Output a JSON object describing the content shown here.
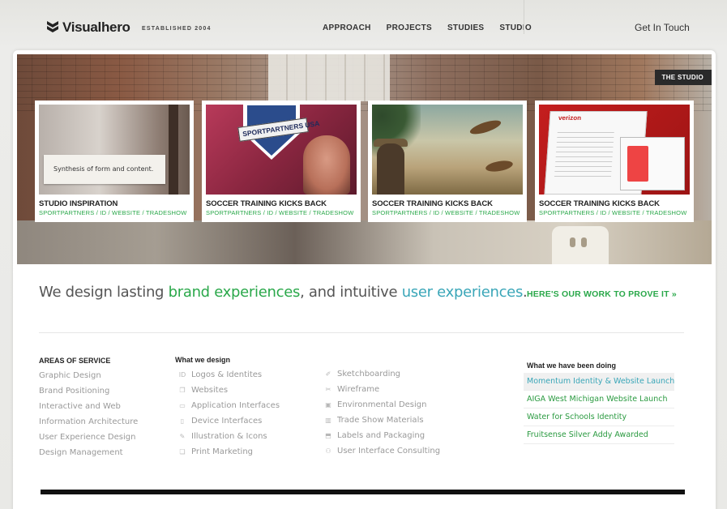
{
  "header": {
    "logo_text": "Visualhero",
    "tagline": "ESTABLISHED 2004",
    "nav": [
      "APPROACH",
      "PROJECTS",
      "STUDIES",
      "STUDIO"
    ],
    "contact": "Get In Touch"
  },
  "hero": {
    "badge": "THE STUDIO",
    "tiles": [
      {
        "title": "STUDIO INSPIRATION",
        "tags": "SPORTPARTNERS / ID / WEBSITE / TRADESHOW",
        "thumb_text": "Synthesis of form and content."
      },
      {
        "title": "SOCCER TRAINING KICKS BACK",
        "tags": "SPORTPARTNERS / ID / WEBSITE / TRADESHOW",
        "thumb_text": "SPORTPARTNERS USA"
      },
      {
        "title": "SOCCER TRAINING KICKS BACK",
        "tags": "SPORTPARTNERS / ID / WEBSITE / TRADESHOW"
      },
      {
        "title": "SOCCER TRAINING KICKS BACK",
        "tags": "SPORTPARTNERS / ID / WEBSITE / TRADESHOW"
      }
    ]
  },
  "headline": {
    "part1": "We design lasting ",
    "brand": "brand experiences",
    "part2": ", and intuitive ",
    "user": "user experiences",
    "part3": ".",
    "cta": "HERE'S OUR WORK TO PROVE IT »"
  },
  "services": {
    "title": "AREAS OF SERVICE",
    "items": [
      "Graphic Design",
      "Brand Positioning",
      "Interactive and Web",
      "Information Architecture",
      "User Experience Design",
      "Design Management"
    ]
  },
  "what_we_design": {
    "title": "What we design",
    "col1": [
      "Logos & Identites",
      "Websites",
      "Application Interfaces",
      "Device Interfaces",
      "Illustration & Icons",
      "Print Marketing"
    ],
    "col2": [
      "Sketchboarding",
      "Wireframe",
      "Environmental Design",
      "Trade Show Materials",
      "Labels and Packaging",
      "User Interface Consulting"
    ]
  },
  "news": {
    "title": "What we have been doing",
    "items": [
      "Momentum Identity & Website Launch",
      "AIGA West Michigan Website Launch",
      "Water for Schools Identity",
      "Fruitsense Silver Addy Awarded"
    ]
  },
  "colors": {
    "accent_green": "#2aa84a",
    "accent_teal": "#3aa6b8"
  }
}
